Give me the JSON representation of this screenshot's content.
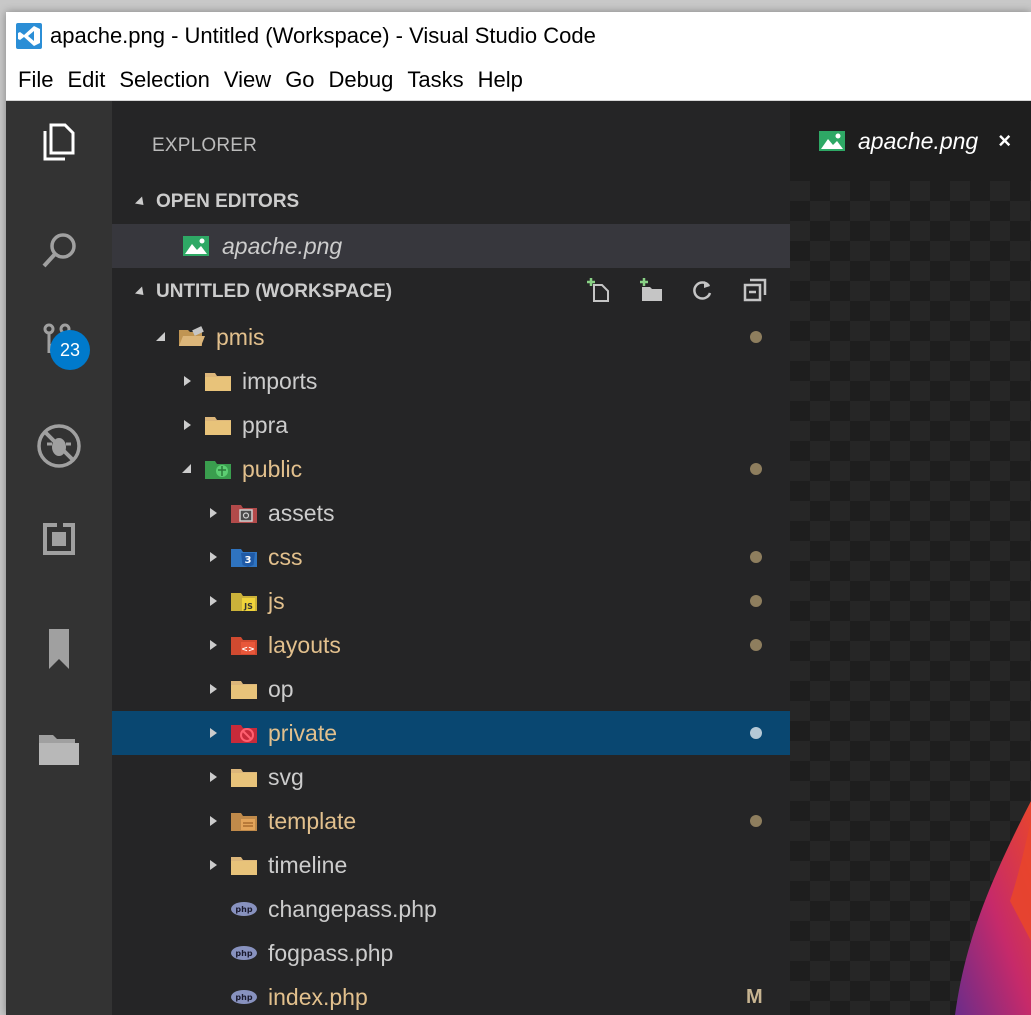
{
  "window": {
    "title": "apache.png - Untitled (Workspace) - Visual Studio Code"
  },
  "menu": [
    "File",
    "Edit",
    "Selection",
    "View",
    "Go",
    "Debug",
    "Tasks",
    "Help"
  ],
  "activity_bar": {
    "items": [
      "explorer-icon",
      "search-icon",
      "source-control-icon",
      "debug-icon",
      "extensions-icon",
      "bookmarks-icon",
      "project-manager-icon"
    ],
    "scm_badge": "23"
  },
  "sidebar": {
    "title": "EXPLORER",
    "open_editors": {
      "header": "OPEN EDITORS",
      "items": [
        {
          "label": "apache.png",
          "icon": "image-icon"
        }
      ]
    },
    "workspace": {
      "header": "UNTITLED (WORKSPACE)",
      "actions": [
        "new-file-icon",
        "new-folder-icon",
        "refresh-icon",
        "collapse-all-icon"
      ],
      "tree": [
        {
          "label": "pmis",
          "depth": 0,
          "type": "folder-open",
          "icon": "folder-open-icon",
          "modified": true
        },
        {
          "label": "imports",
          "depth": 1,
          "type": "folder",
          "icon": "folder-icon",
          "modified": false
        },
        {
          "label": "ppra",
          "depth": 1,
          "type": "folder",
          "icon": "folder-icon",
          "modified": false
        },
        {
          "label": "public",
          "depth": 1,
          "type": "folder-open",
          "icon": "folder-public-icon",
          "modified": true
        },
        {
          "label": "assets",
          "depth": 2,
          "type": "folder",
          "icon": "folder-assets-icon",
          "modified": false
        },
        {
          "label": "css",
          "depth": 2,
          "type": "folder",
          "icon": "folder-css-icon",
          "modified": true
        },
        {
          "label": "js",
          "depth": 2,
          "type": "folder",
          "icon": "folder-js-icon",
          "modified": true
        },
        {
          "label": "layouts",
          "depth": 2,
          "type": "folder",
          "icon": "folder-layouts-icon",
          "modified": true
        },
        {
          "label": "op",
          "depth": 2,
          "type": "folder",
          "icon": "folder-icon",
          "modified": false
        },
        {
          "label": "private",
          "depth": 2,
          "type": "folder",
          "icon": "folder-private-icon",
          "modified": true,
          "selected": true
        },
        {
          "label": "svg",
          "depth": 2,
          "type": "folder",
          "icon": "folder-icon",
          "modified": false
        },
        {
          "label": "template",
          "depth": 2,
          "type": "folder",
          "icon": "folder-template-icon",
          "modified": true
        },
        {
          "label": "timeline",
          "depth": 2,
          "type": "folder",
          "icon": "folder-icon",
          "modified": false
        },
        {
          "label": "changepass.php",
          "depth": 2,
          "type": "file",
          "icon": "php-file-icon",
          "modified": false
        },
        {
          "label": "fogpass.php",
          "depth": 2,
          "type": "file",
          "icon": "php-file-icon",
          "modified": false
        },
        {
          "label": "index.php",
          "depth": 2,
          "type": "file",
          "icon": "php-file-icon",
          "modified": true,
          "status": "M"
        }
      ]
    }
  },
  "editor": {
    "tab": {
      "label": "apache.png",
      "close": "×"
    }
  },
  "colors": {
    "accent": "#007acc",
    "selection": "#094771",
    "modified_text": "#e2c08d"
  }
}
